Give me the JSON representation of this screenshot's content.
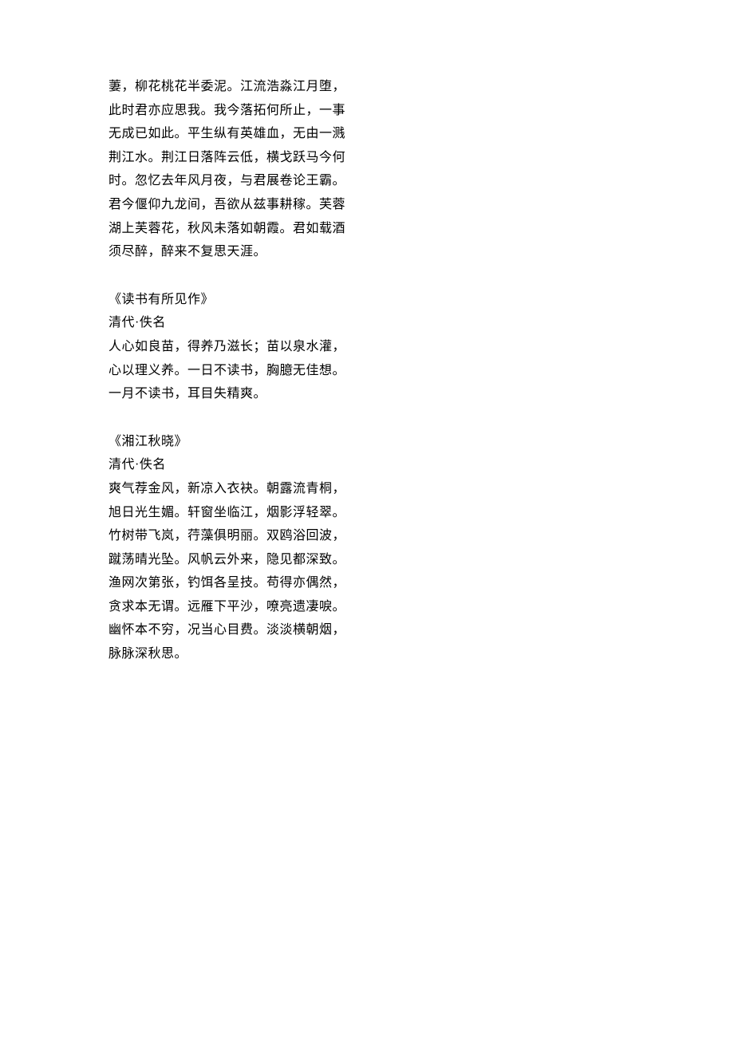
{
  "poems": [
    {
      "lines": [
        "萋，柳花桃花半委泥。江流浩淼江月堕，",
        "此时君亦应思我。我今落拓何所止，一事",
        "无成已如此。平生纵有英雄血，无由一溅",
        "荆江水。荆江日落阵云低，横戈跃马今何",
        "时。忽忆去年风月夜，与君展卷论王霸。",
        "君今偃仰九龙间，吾欲从兹事耕稼。芙蓉",
        "湖上芙蓉花，秋风未落如朝霞。君如载酒",
        "须尽醉，醉来不复思天涯。"
      ]
    },
    {
      "title": "《读书有所见作》",
      "author": "清代·佚名",
      "lines": [
        "人心如良苗，得养乃滋长；苗以泉水灌，",
        "心以理义养。一日不读书，胸臆无佳想。",
        "一月不读书，耳目失精爽。"
      ]
    },
    {
      "title": "《湘江秋晓》",
      "author": "清代·佚名",
      "lines": [
        "爽气荐金风，新凉入衣袂。朝露流青桐，",
        "旭日光生媚。轩窗坐临江，烟影浮轻翠。",
        "竹树带飞岚，荇藻俱明丽。双鸥浴回波，",
        "蹴荡晴光坠。风帆云外来，隐见都深致。",
        "渔网次第张，钓饵各呈技。苟得亦偶然，",
        "贪求本无谓。远雁下平沙，嘹亮遗凄唳。",
        "幽怀本不穷，况当心目费。淡淡横朝烟，",
        "脉脉深秋思。"
      ]
    }
  ]
}
